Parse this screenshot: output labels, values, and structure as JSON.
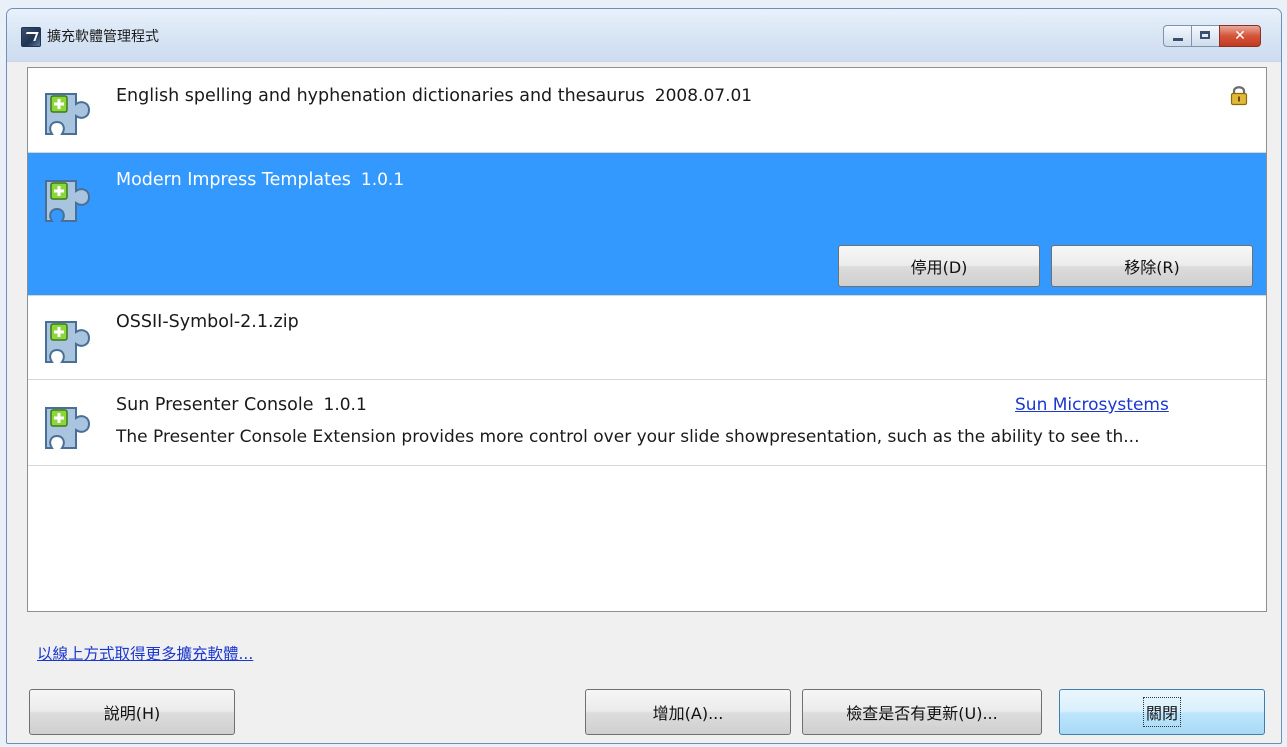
{
  "window": {
    "title": "擴充軟體管理程式",
    "controls": {
      "minimize": "minimize",
      "maximize": "maximize",
      "close": "✕"
    }
  },
  "extensions": [
    {
      "name": "English spelling and hyphenation dictionaries and thesaurus",
      "version": "2008.07.01",
      "locked": true,
      "selected": false
    },
    {
      "name": "Modern Impress Templates",
      "version": "1.0.1",
      "selected": true,
      "buttons": {
        "disable": "停用(D)",
        "remove": "移除(R)"
      }
    },
    {
      "name": "OSSII-Symbol-2.1.zip",
      "version": "",
      "selected": false
    },
    {
      "name": "Sun Presenter Console",
      "version": "1.0.1",
      "publisher": "Sun Microsystems",
      "description": "The Presenter Console Extension provides more control over your slide showpresentation, such as the ability to see th...",
      "selected": false
    }
  ],
  "footer": {
    "get_more_link": "以線上方式取得更多擴充軟體...",
    "help_button": "說明(H)",
    "add_button": "增加(A)...",
    "check_updates_button": "檢查是否有更新(U)...",
    "close_button": "關閉"
  },
  "colors": {
    "selection": "#3399ff",
    "link": "#1a37cf",
    "puzzle_blue": "#a9c4de",
    "plus_green": "#8bd63a"
  },
  "icons": {
    "extension": "puzzle-piece-icon",
    "lock": "lock-icon",
    "app": "extension-manager-app-icon"
  }
}
